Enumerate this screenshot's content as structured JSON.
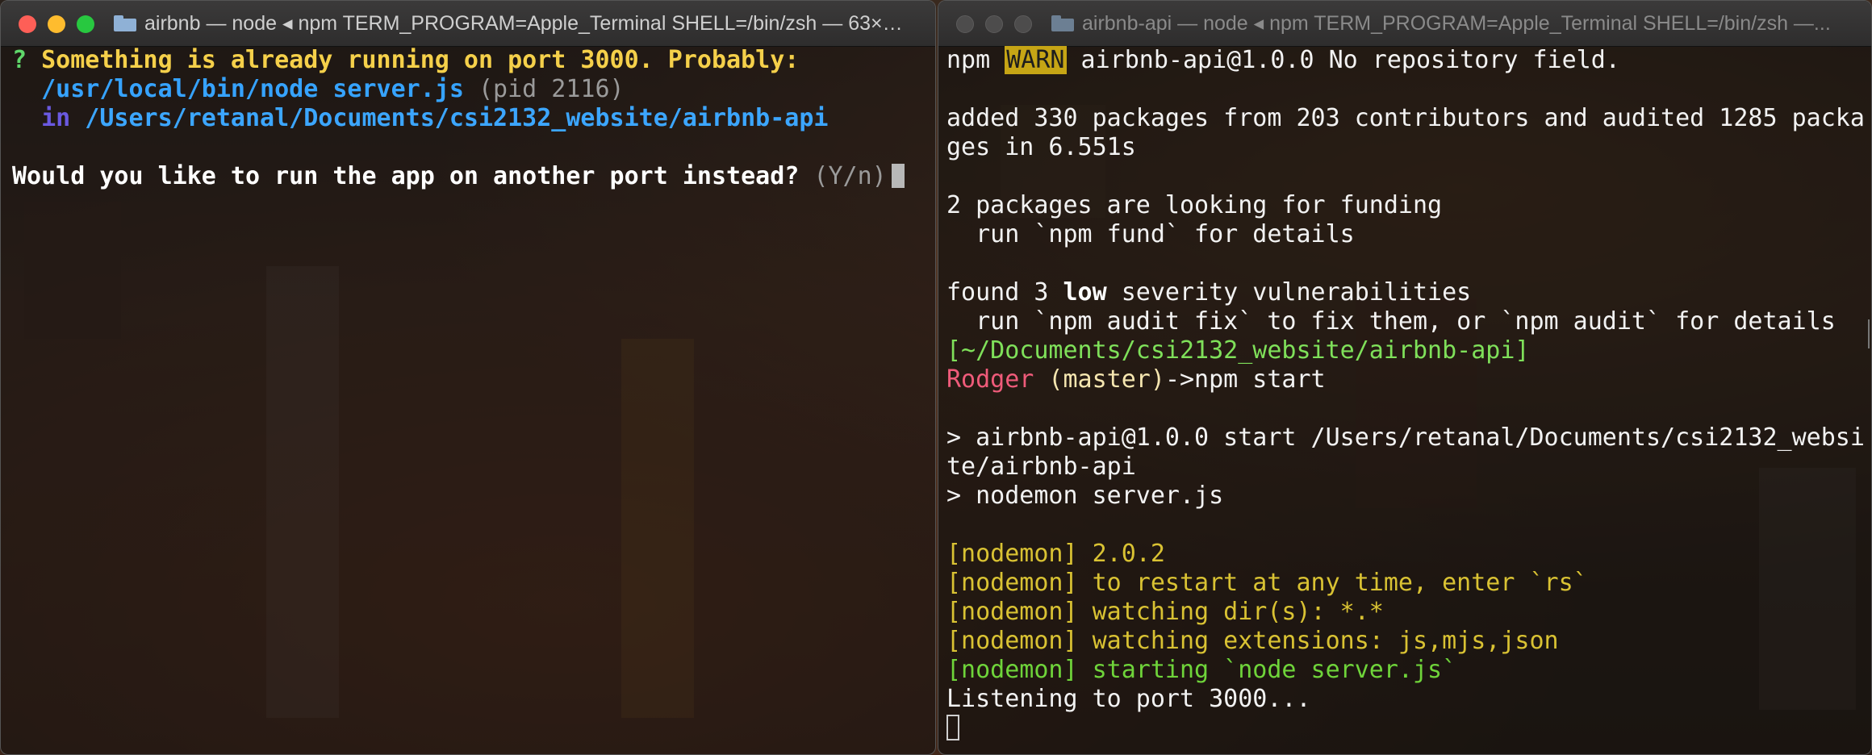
{
  "left_window": {
    "title": "airbnb — node ◂ npm TERM_PROGRAM=Apple_Terminal SHELL=/bin/zsh — 63×…",
    "lines": {
      "l1_q": "?",
      "l1_text": " Something is already running on port 3000. Probably:",
      "l2_cmd": "  /usr/local/bin/node server.js",
      "l2_pid": " (pid 2116)",
      "l3_in": "  in",
      "l3_path": " /Users/retanal/Documents/csi2132_website/airbnb-api",
      "l5_question": "Would you like to run the app on another port instead?",
      "l5_hint": " (Y/n)"
    }
  },
  "right_window": {
    "title": "airbnb-api — node ◂ npm TERM_PROGRAM=Apple_Terminal SHELL=/bin/zsh —...",
    "lines": {
      "r1_npm": "npm ",
      "r1_warn": "WARN",
      "r1_rest": " airbnb-api@1.0.0 No repository field.",
      "r3": "added 330 packages from 203 contributors and audited 1285 packa",
      "r4": "ges in 6.551s",
      "r6": "2 packages are looking for funding",
      "r7": "  run `npm fund` for details",
      "r9_a": "found 3 ",
      "r9_b": "low",
      "r9_c": " severity vulnerabilities",
      "r10": "  run `npm audit fix` to fix them, or `npm audit` for details",
      "r11": "[~/Documents/csi2132_website/airbnb-api]",
      "r12_user": "Rodger",
      "r12_branch": " (master)",
      "r12_cmd": "->npm start",
      "r14": "> airbnb-api@1.0.0 start /Users/retanal/Documents/csi2132_websi",
      "r15": "te/airbnb-api",
      "r16": "> nodemon server.js",
      "r18": "[nodemon] 2.0.2",
      "r19": "[nodemon] to restart at any time, enter `rs`",
      "r20": "[nodemon] watching dir(s): *.*",
      "r21": "[nodemon] watching extensions: js,mjs,json",
      "r22": "[nodemon] starting `node server.js`",
      "r23": "Listening to port 3000..."
    }
  }
}
